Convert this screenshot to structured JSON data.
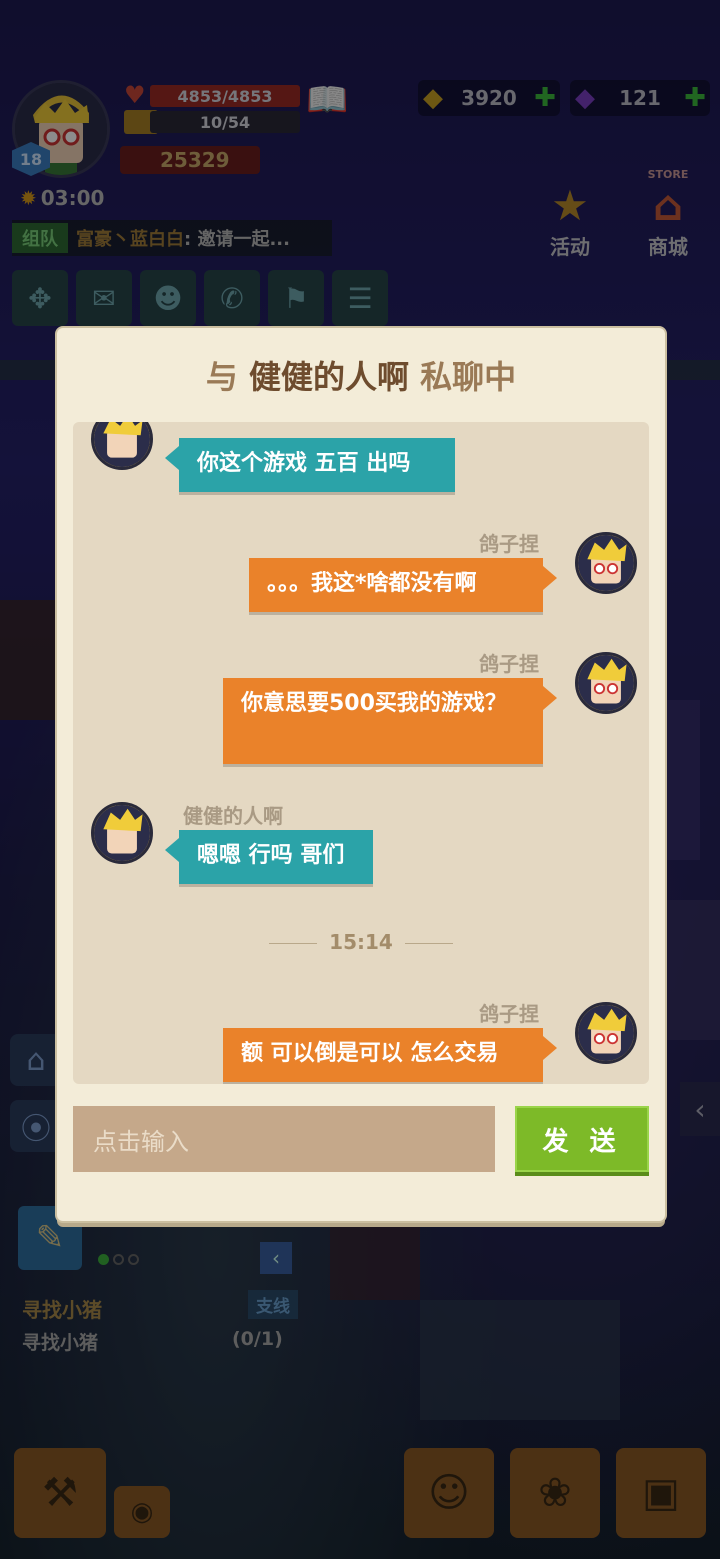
{
  "hud": {
    "level": "18",
    "hp": "4853/4853",
    "xp": "10/54",
    "power": "25329",
    "clock": "03:00",
    "gold": "3920",
    "gems": "121",
    "activity_label": "活动",
    "store_label": "商城",
    "store_sign": "STORE",
    "team_tag": "组队",
    "team_name": "富豪丶蓝白白",
    "team_msg": ": 邀请一起..."
  },
  "quest": {
    "title": "寻找小猪",
    "tag": "支线",
    "desc": "寻找小猪",
    "progress": "(0/1)"
  },
  "dialog": {
    "title_prefix": "与",
    "title_name": "健健的人啊",
    "title_suffix": "私聊中",
    "time_separator": "15:14",
    "input_placeholder": "点击输入",
    "send_label": "发 送",
    "messages": [
      {
        "sender": "",
        "text": "你这个游戏 五百 出吗",
        "side": "left"
      },
      {
        "sender": "鸽子捏",
        "text": "。。。我这*啥都没有啊",
        "side": "right"
      },
      {
        "sender": "鸽子捏",
        "text": "你意思要500买我的游戏？",
        "side": "right"
      },
      {
        "sender": "健健的人啊",
        "text": "嗯嗯 行吗 哥们",
        "side": "left"
      },
      {
        "sender": "鸽子捏",
        "text": "额 可以倒是可以 怎么交易",
        "side": "right"
      }
    ]
  },
  "colors": {
    "teal_bubble": "#2ba3a8",
    "orange_bubble": "#ea822a",
    "send_button": "#7dba28",
    "dialog_bg": "#f3ecd8"
  }
}
